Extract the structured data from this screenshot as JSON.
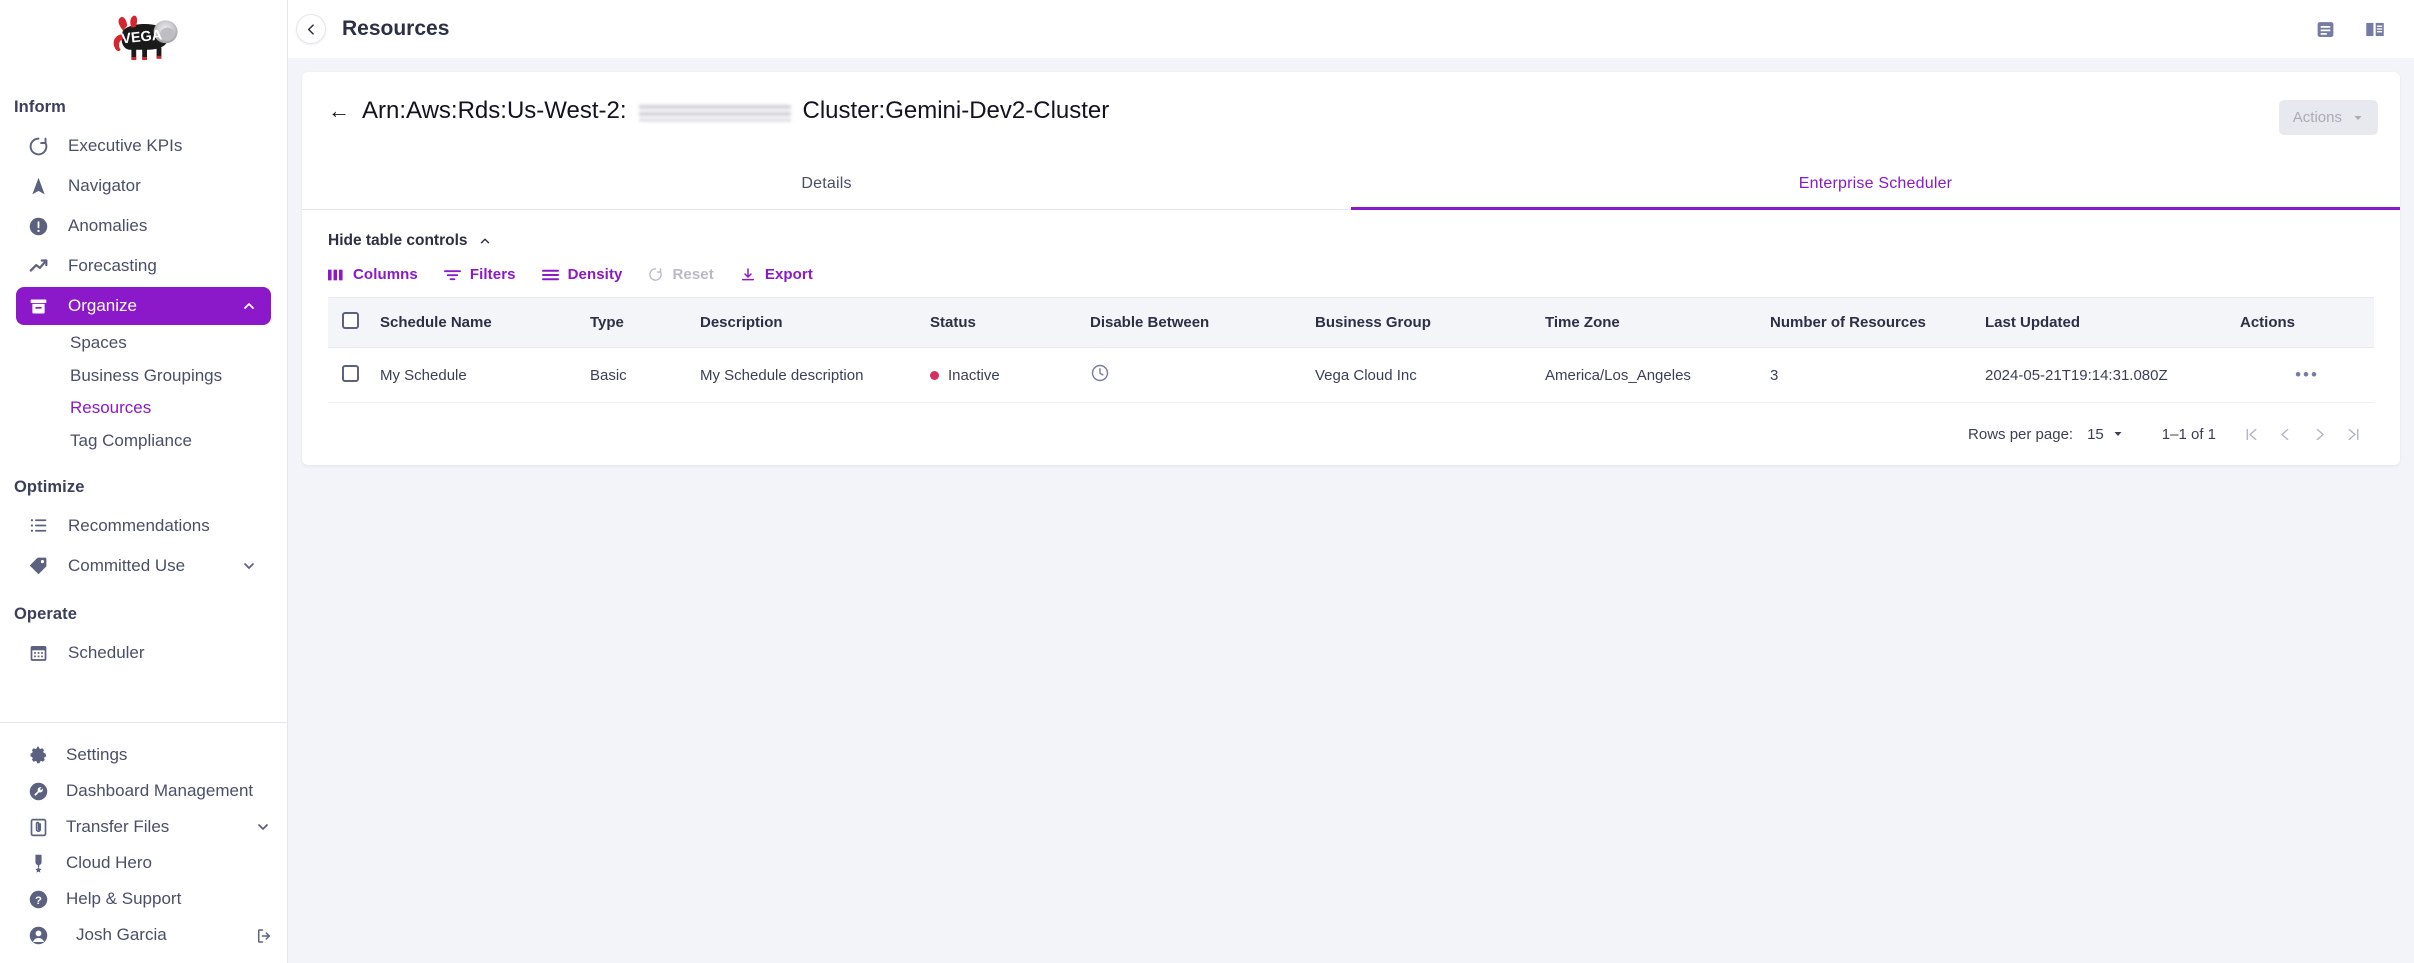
{
  "app": {
    "logo_alt": "Vega cow logo",
    "brand": "VEGA",
    "accent_purple": "#8B18C9",
    "status_red": "#D62F5E",
    "page_bg": "#f3f4f9"
  },
  "topbar": {
    "title": "Resources",
    "back_icon": "chevron-left-icon",
    "icons": [
      {
        "name": "notes-panel-icon",
        "glyph": "notes"
      },
      {
        "name": "open-book-icon",
        "glyph": "book"
      }
    ]
  },
  "sidebar": {
    "sections": [
      {
        "label": "Inform",
        "items": [
          {
            "label": "Executive KPIs",
            "icon": "gauge-icon",
            "active": false,
            "expandable": false
          },
          {
            "label": "Navigator",
            "icon": "navigation-arrow-icon",
            "active": false,
            "expandable": false
          },
          {
            "label": "Anomalies",
            "icon": "alert-circle-icon",
            "active": false,
            "expandable": false
          },
          {
            "label": "Forecasting",
            "icon": "trend-up-icon",
            "active": false,
            "expandable": false
          },
          {
            "label": "Organize",
            "icon": "archive-box-icon",
            "active": true,
            "expandable": true,
            "expanded": true
          }
        ],
        "sub_items": [
          {
            "label": "Spaces",
            "current": false
          },
          {
            "label": "Business Groupings",
            "current": false
          },
          {
            "label": "Resources",
            "current": true
          },
          {
            "label": "Tag Compliance",
            "current": false
          }
        ]
      },
      {
        "label": "Optimize",
        "items": [
          {
            "label": "Recommendations",
            "icon": "list-icon",
            "active": false,
            "expandable": false
          },
          {
            "label": "Committed Use",
            "icon": "tag-icon",
            "active": false,
            "expandable": true,
            "expanded": false
          }
        ],
        "sub_items": []
      },
      {
        "label": "Operate",
        "items": [
          {
            "label": "Scheduler",
            "icon": "calendar-icon",
            "active": false,
            "expandable": false
          }
        ],
        "sub_items": []
      }
    ],
    "footer_items": [
      {
        "label": "Settings",
        "icon": "gear-icon",
        "expandable": false
      },
      {
        "label": "Dashboard Management",
        "icon": "wrench-circle-icon",
        "expandable": false
      },
      {
        "label": "Transfer Files",
        "icon": "paperclip-box-icon",
        "expandable": true
      },
      {
        "label": "Cloud Hero",
        "icon": "medal-icon",
        "expandable": false
      },
      {
        "label": "Help & Support",
        "icon": "question-circle-icon",
        "expandable": false
      }
    ],
    "user": {
      "name": "Josh Garcia",
      "avatar_icon": "user-circle-icon",
      "logout_icon": "logout-icon"
    }
  },
  "resource": {
    "back_arrow": "arrow-left-icon",
    "title_prefix": "Arn:Aws:Rds:Us-West-2:",
    "title_redacted": true,
    "title_suffix": "Cluster:Gemini-Dev2-Cluster",
    "actions_label": "Actions",
    "actions_disabled": true,
    "actions_caret": "caret-down-icon"
  },
  "tabs": [
    {
      "label": "Details",
      "selected": false
    },
    {
      "label": "Enterprise Scheduler",
      "selected": true
    }
  ],
  "table_controls": {
    "toggle_label": "Hide table controls",
    "toggle_caret": "chevron-up-icon",
    "buttons": [
      {
        "label": "Columns",
        "icon": "columns-icon",
        "disabled": false
      },
      {
        "label": "Filters",
        "icon": "funnel-icon",
        "disabled": false
      },
      {
        "label": "Density",
        "icon": "density-lines-icon",
        "disabled": false
      },
      {
        "label": "Reset",
        "icon": "reset-circle-icon",
        "disabled": true
      },
      {
        "label": "Export",
        "icon": "download-icon",
        "disabled": false
      }
    ]
  },
  "table": {
    "columns": [
      {
        "key": "checkbox",
        "label": ""
      },
      {
        "key": "schedule_name",
        "label": "Schedule Name"
      },
      {
        "key": "type",
        "label": "Type"
      },
      {
        "key": "description",
        "label": "Description"
      },
      {
        "key": "status",
        "label": "Status"
      },
      {
        "key": "disable_between",
        "label": "Disable Between"
      },
      {
        "key": "business_group",
        "label": "Business Group"
      },
      {
        "key": "time_zone",
        "label": "Time Zone"
      },
      {
        "key": "number_of_resources",
        "label": "Number of Resources"
      },
      {
        "key": "last_updated",
        "label": "Last Updated"
      },
      {
        "key": "actions",
        "label": "Actions"
      }
    ],
    "rows": [
      {
        "checked": false,
        "schedule_name": "My Schedule",
        "type": "Basic",
        "description": "My Schedule description",
        "status": "Inactive",
        "disable_between_icon": "clock-icon",
        "business_group": "Vega Cloud Inc",
        "time_zone": "America/Los_Angeles",
        "number_of_resources": "3",
        "last_updated": "2024-05-21T19:14:31.080Z",
        "actions_icon": "more-horizontal-icon"
      }
    ],
    "select_all_checked": false
  },
  "pagination": {
    "rows_per_page_label": "Rows per page:",
    "rows_per_page_value": "15",
    "range_label": "1–1 of 1",
    "first_icon": "first-page-icon",
    "prev_icon": "prev-page-icon",
    "next_icon": "next-page-icon",
    "last_icon": "last-page-icon"
  }
}
